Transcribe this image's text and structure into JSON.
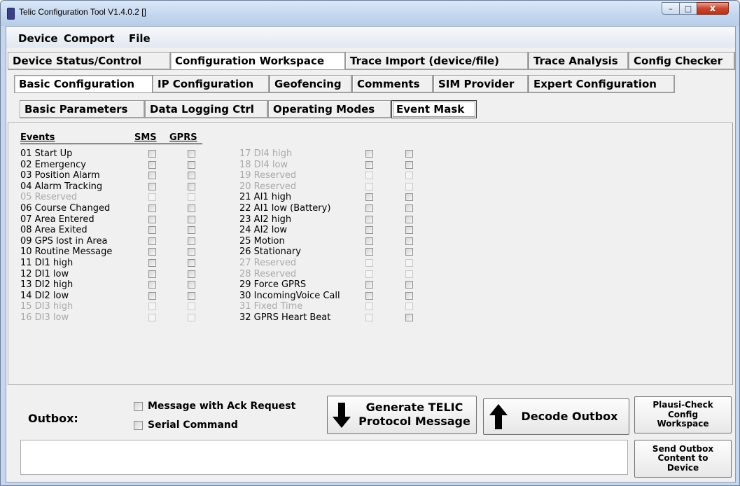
{
  "window": {
    "title": "Telic Configuration Tool V1.4.0.2 []",
    "min_symbol": "–",
    "max_symbol": "□",
    "close_symbol": "x"
  },
  "menu": [
    "Device",
    "Comport",
    "File"
  ],
  "main_tabs": [
    {
      "label": "Device Status/Control",
      "active": false
    },
    {
      "label": "Configuration Workspace",
      "active": true
    },
    {
      "label": "Trace Import (device/file)",
      "active": false
    },
    {
      "label": "Trace Analysis",
      "active": false
    },
    {
      "label": "Config Checker",
      "active": false
    }
  ],
  "config_tabs": [
    {
      "label": "Basic Configuration",
      "active": true
    },
    {
      "label": "IP Configuration",
      "active": false
    },
    {
      "label": "Geofencing",
      "active": false
    },
    {
      "label": "Comments",
      "active": false
    },
    {
      "label": "SIM Provider",
      "active": false
    },
    {
      "label": "Expert Configuration",
      "active": false
    }
  ],
  "basic_tabs": [
    {
      "label": "Basic Parameters",
      "active": false
    },
    {
      "label": "Data Logging Ctrl",
      "active": false
    },
    {
      "label": "Operating Modes",
      "active": false
    },
    {
      "label": "Event Mask",
      "active": true
    }
  ],
  "event_mask": {
    "headers": {
      "events": "Events",
      "sms": "SMS",
      "gprs": "GPRS"
    },
    "left_events": [
      {
        "label": "01 Start Up",
        "enabled": true,
        "sms": true,
        "gprs": true
      },
      {
        "label": "02 Emergency",
        "enabled": true,
        "sms": true,
        "gprs": true
      },
      {
        "label": "03 Position Alarm",
        "enabled": true,
        "sms": true,
        "gprs": true
      },
      {
        "label": "04 Alarm Tracking",
        "enabled": true,
        "sms": true,
        "gprs": true
      },
      {
        "label": "05 Reserved",
        "enabled": false,
        "sms": false,
        "gprs": false
      },
      {
        "label": "06 Course Changed",
        "enabled": true,
        "sms": true,
        "gprs": true
      },
      {
        "label": "07 Area Entered",
        "enabled": true,
        "sms": true,
        "gprs": true
      },
      {
        "label": "08 Area Exited",
        "enabled": true,
        "sms": true,
        "gprs": true
      },
      {
        "label": "09 GPS lost in Area",
        "enabled": true,
        "sms": true,
        "gprs": true
      },
      {
        "label": "10 Routine Message",
        "enabled": true,
        "sms": true,
        "gprs": true
      },
      {
        "label": "11 DI1 high",
        "enabled": true,
        "sms": true,
        "gprs": true
      },
      {
        "label": "12 DI1 low",
        "enabled": true,
        "sms": true,
        "gprs": true
      },
      {
        "label": "13 DI2 high",
        "enabled": true,
        "sms": true,
        "gprs": true
      },
      {
        "label": "14 DI2 low",
        "enabled": true,
        "sms": true,
        "gprs": true
      },
      {
        "label": "15 DI3 high",
        "enabled": false,
        "sms": false,
        "gprs": false
      },
      {
        "label": "16 DI3 low",
        "enabled": false,
        "sms": false,
        "gprs": false
      }
    ],
    "right_events": [
      {
        "label": "17 DI4 high",
        "enabled": false,
        "sms": true,
        "gprs": true
      },
      {
        "label": "18 DI4 low",
        "enabled": false,
        "sms": true,
        "gprs": true
      },
      {
        "label": "19 Reserved",
        "enabled": false,
        "sms": false,
        "gprs": false
      },
      {
        "label": "20 Reserved",
        "enabled": false,
        "sms": false,
        "gprs": false
      },
      {
        "label": "21 AI1 high",
        "enabled": true,
        "sms": true,
        "gprs": true
      },
      {
        "label": "22 AI1 low (Battery)",
        "enabled": true,
        "sms": true,
        "gprs": true
      },
      {
        "label": "23 AI2 high",
        "enabled": true,
        "sms": true,
        "gprs": true
      },
      {
        "label": "24 AI2 low",
        "enabled": true,
        "sms": true,
        "gprs": true
      },
      {
        "label": "25 Motion",
        "enabled": true,
        "sms": true,
        "gprs": true
      },
      {
        "label": "26 Stationary",
        "enabled": true,
        "sms": true,
        "gprs": true
      },
      {
        "label": "27 Reserved",
        "enabled": false,
        "sms": false,
        "gprs": false
      },
      {
        "label": "28 Reserved",
        "enabled": false,
        "sms": false,
        "gprs": false
      },
      {
        "label": "29 Force GPRS",
        "enabled": true,
        "sms": true,
        "gprs": true
      },
      {
        "label": "30 IncomingVoice Call",
        "enabled": true,
        "sms": true,
        "gprs": true
      },
      {
        "label": "31 Fixed Time",
        "enabled": false,
        "sms": false,
        "gprs": false
      },
      {
        "label": "32 GPRS Heart Beat",
        "enabled": true,
        "sms": false,
        "gprs": true
      }
    ]
  },
  "outbox": {
    "label": "Outbox:",
    "ack_request_label": "Message with Ack Request",
    "serial_command_label": "Serial Command",
    "generate_line1": "Generate TELIC",
    "generate_line2": "Protocol Message",
    "decode_label": "Decode Outbox",
    "plausi_line1": "Plausi-Check",
    "plausi_line2": "Config",
    "plausi_line3": "Workspace",
    "send_line1": "Send Outbox",
    "send_line2": "Content to",
    "send_line3": "Device",
    "text_value": ""
  },
  "icons": {
    "app": "telic-app-icon",
    "generate": "arrow-down-icon",
    "decode": "arrow-up-icon"
  }
}
